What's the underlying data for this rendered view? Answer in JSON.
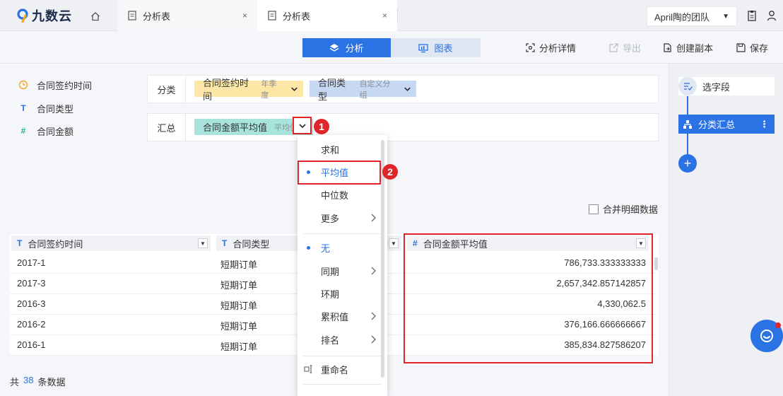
{
  "app": {
    "name": "九数云"
  },
  "tabs": [
    {
      "label": "分析表",
      "close": "×"
    },
    {
      "label": "分析表",
      "close": "×"
    }
  ],
  "team": {
    "label": "April陶的团队",
    "caret": "▼"
  },
  "toolbar": {
    "analysis_label": "分析",
    "chart_label": "图表",
    "detail_label": "分析详情",
    "export_label": "导出",
    "copy_label": "创建副本",
    "save_label": "保存"
  },
  "fields": [
    {
      "icon": "clock-icon",
      "label": "合同签约时间",
      "color": "#f5a623"
    },
    {
      "icon": "text-icon",
      "glyph": "T",
      "label": "合同类型",
      "color": "#2b72e4"
    },
    {
      "icon": "number-icon",
      "glyph": "#",
      "label": "合同金额",
      "color": "#1fb39a"
    }
  ],
  "category_row": {
    "label": "分类",
    "chips": [
      {
        "label": "合同签约时间",
        "sub": "年季度",
        "color": "#fde7a6"
      },
      {
        "label": "合同类型",
        "sub": "自定义分组",
        "color": "#c7d8f3"
      }
    ]
  },
  "summary_row": {
    "label": "汇总",
    "chip": {
      "label": "合同金额平均值",
      "sub": "平均值",
      "color": "#a8e4dc"
    }
  },
  "annotations": {
    "badge1": "1",
    "badge2": "2",
    "accent_red": "#e0262b"
  },
  "menu": {
    "items": [
      {
        "label": "求和"
      },
      {
        "label": "平均值",
        "selected": true
      },
      {
        "label": "中位数"
      },
      {
        "label": "更多",
        "submenu": true
      },
      {
        "label": "无",
        "selected": true
      },
      {
        "label": "同期",
        "submenu": true
      },
      {
        "label": "环期"
      },
      {
        "label": "累积值",
        "submenu": true
      },
      {
        "label": "排名",
        "submenu": true
      },
      {
        "label": "重命名"
      }
    ]
  },
  "right_panel": {
    "step_select": "选字段",
    "step_summary": "分类汇总",
    "more": "⋮",
    "add": "+"
  },
  "merge_checkbox": {
    "label": "合并明细数据"
  },
  "table": {
    "columns": [
      {
        "type_icon": "T",
        "label": "合同签约时间"
      },
      {
        "type_icon": "T",
        "label": "合同类型"
      },
      {
        "type_icon": "#",
        "label": "合同金额平均值"
      }
    ],
    "rows": [
      [
        "2017-1",
        "短期订单",
        "786,733.333333333"
      ],
      [
        "2017-3",
        "短期订单",
        "2,657,342.857142857"
      ],
      [
        "2016-3",
        "短期订单",
        "4,330,062.5"
      ],
      [
        "2016-2",
        "短期订单",
        "376,166.666666667"
      ],
      [
        "2016-1",
        "短期订单",
        "385,834.827586207"
      ]
    ]
  },
  "footer": {
    "prefix": "共",
    "count": "38",
    "suffix": "条数据"
  },
  "colors": {
    "primary": "#2b72e4",
    "red": "#e0262b"
  }
}
